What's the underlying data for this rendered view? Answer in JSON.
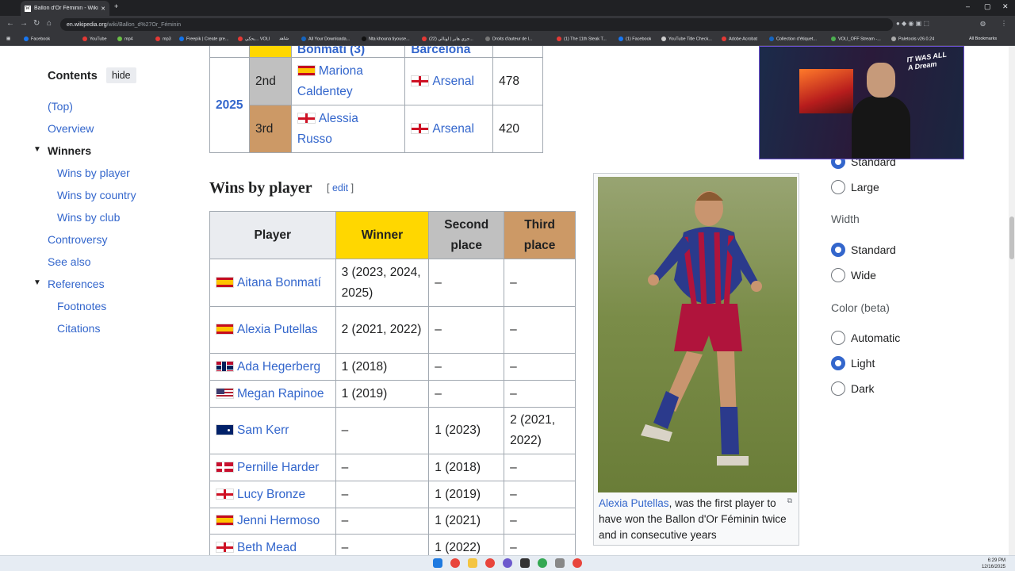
{
  "browser": {
    "tab_title": "Ballon d'Or Féminin - Wikipedia",
    "tab_icon": "W",
    "url_domain": "en.wikipedia.org",
    "url_path": "/wiki/Ballon_d%27Or_Féminin",
    "bookmarks": [
      "Facebook",
      "YouTube",
      "mp4",
      "mp3",
      "Freepik | Create gre...",
      "بحكي... VOLI",
      "شاهد",
      "All Your Downloada...",
      "Nta khouna tiyouse...",
      "(22) جزي هابر | لونالي...",
      "Droits d'auteur de l...",
      "(1) The 11th Steak T...",
      "(1) Facebook",
      "YouTube Title Check...",
      "Adobe Acrobat",
      "Collection d'étiquet...",
      "VOLI_OFF Stream -...",
      "Paletools v26.0.24"
    ],
    "all_bookmarks": "All Bookmarks"
  },
  "toc": {
    "heading": "Contents",
    "hide": "hide",
    "items": [
      "(Top)",
      "Overview",
      "Winners",
      "Wins by player",
      "Wins by country",
      "Wins by club",
      "Controversy",
      "See also",
      "References",
      "Footnotes",
      "Citations"
    ]
  },
  "top_table": {
    "partial_player": "Bonmatí (3)",
    "partial_club": "Barcelona",
    "year": "2025",
    "rows": [
      {
        "place": "2nd",
        "player_line1": "Mariona",
        "player_line2": "Caldentey",
        "club": "Arsenal",
        "points": "478"
      },
      {
        "place": "3rd",
        "player_line1": "Alessia",
        "player_line2": "Russo",
        "club": "Arsenal",
        "points": "420"
      }
    ]
  },
  "section": {
    "title": "Wins by player",
    "edit": "edit",
    "bracket_open": "[",
    "bracket_close": "]"
  },
  "wins_table": {
    "headers": [
      "Player",
      "Winner",
      "Second place",
      "Third place"
    ],
    "header_second": [
      "Second",
      "place"
    ],
    "header_third": [
      "Third",
      "place"
    ],
    "rows": [
      {
        "player": "Aitana Bonmatí",
        "winner": "3 (2023, 2024, 2025)",
        "second": "–",
        "third": "–"
      },
      {
        "player": "Alexia Putellas",
        "winner": "2 (2021, 2022)",
        "second": "–",
        "third": "–"
      },
      {
        "player": "Ada Hegerberg",
        "winner": "1 (2018)",
        "second": "–",
        "third": "–"
      },
      {
        "player": "Megan Rapinoe",
        "winner": "1 (2019)",
        "second": "–",
        "third": "–"
      },
      {
        "player": "Sam Kerr",
        "winner": "–",
        "second": "1 (2023)",
        "third": "2 (2021, 2022)"
      },
      {
        "player": "Pernille Harder",
        "winner": "–",
        "second": "1 (2018)",
        "third": "–"
      },
      {
        "player": "Lucy Bronze",
        "winner": "–",
        "second": "1 (2019)",
        "third": "–"
      },
      {
        "player": "Jenni Hermoso",
        "winner": "–",
        "second": "1 (2021)",
        "third": "–"
      },
      {
        "player": "Beth Mead",
        "winner": "–",
        "second": "1 (2022)",
        "third": "–"
      }
    ]
  },
  "image_caption": {
    "link": "Alexia Putellas",
    "text": ", was the first player to have won the Ballon d'Or Féminin twice and in consecutive years"
  },
  "appearance": {
    "options_text": [
      "Standard",
      "Large"
    ],
    "width_label": "Width",
    "options_width": [
      "Standard",
      "Wide"
    ],
    "color_label": "Color (beta)",
    "options_color": [
      "Automatic",
      "Light",
      "Dark"
    ]
  },
  "webcam": {
    "line1": "IT WAS ALL",
    "line2": "A Dream"
  },
  "clock": {
    "time": "6:29 PM",
    "date": "12/16/2025"
  },
  "colors": {
    "link": "#3366cc",
    "gold": "#ffd700",
    "silver": "#c0c0c0",
    "bronze": "#cc9966",
    "radio_on": "#3366cc"
  }
}
